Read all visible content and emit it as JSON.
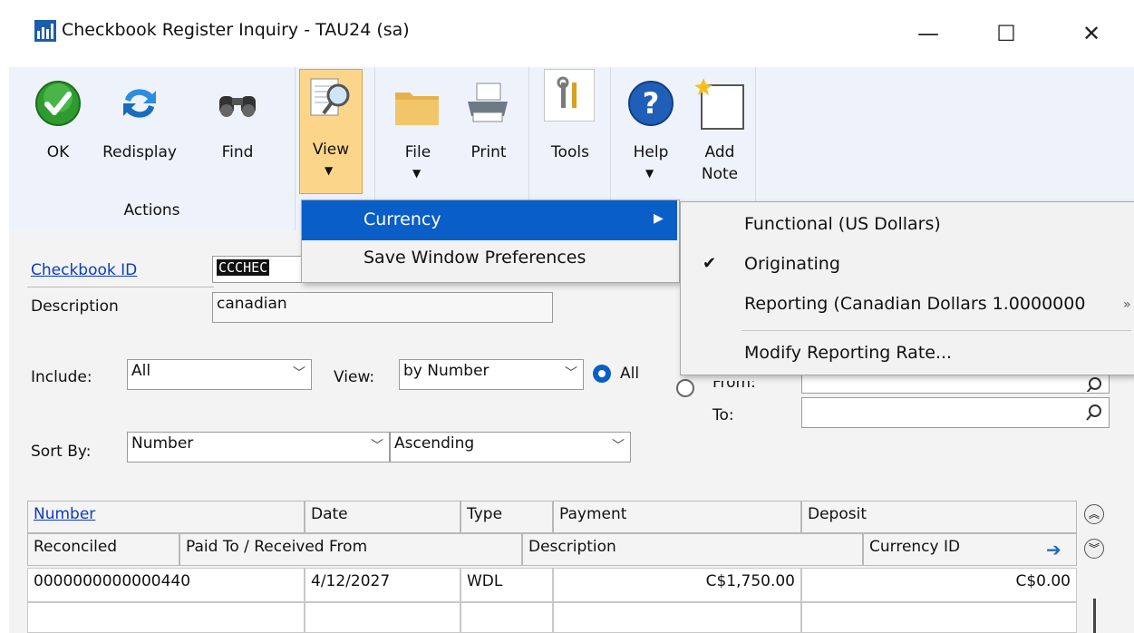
{
  "window": {
    "title": "Checkbook Register Inquiry  -  TAU24 (sa)",
    "minimize": "—",
    "maximize": "☐",
    "close": "✕"
  },
  "ribbon": {
    "ok": "OK",
    "redisplay": "Redisplay",
    "find": "Find",
    "view": "View",
    "file": "File",
    "print": "Print",
    "tools": "Tools",
    "help": "Help",
    "add_note_line1": "Add",
    "add_note_line2": "Note",
    "group_actions": "Actions"
  },
  "view_menu": {
    "currency": "Currency",
    "save_prefs": "Save Window Preferences"
  },
  "currency_submenu": {
    "functional": "Functional (US Dollars)",
    "originating": "Originating",
    "reporting": "Reporting (Canadian Dollars 1.0000000",
    "modify_rate": "Modify Reporting Rate...",
    "checked_item": "originating"
  },
  "form": {
    "checkbook_id_label": "Checkbook ID",
    "checkbook_id_value": "CCCHEC",
    "description_label": "Description",
    "description_value": "canadian",
    "include_label": "Include:",
    "include_value": "All",
    "view_label": "View:",
    "view_value": "by Number",
    "radio_all_label": "All",
    "from_label": "From:",
    "to_label": "To:",
    "sort_by_label": "Sort By:",
    "sort_by_value": "Number",
    "sort_order_value": "Ascending"
  },
  "grid": {
    "header_row1": [
      "Number",
      "Date",
      "Type",
      "Payment",
      "Deposit"
    ],
    "header_row2": [
      "Reconciled",
      "Paid To / Received From",
      "Description",
      "Currency ID"
    ],
    "rows": [
      {
        "number": "0000000000000440",
        "date": "4/12/2027",
        "type": "WDL",
        "payment": "C$1,750.00",
        "deposit": "C$0.00"
      }
    ]
  },
  "colors": {
    "accent_blue": "#0a3bc7",
    "menu_highlight": "#0a5ec8",
    "view_button_bg": "#fbd68a"
  }
}
